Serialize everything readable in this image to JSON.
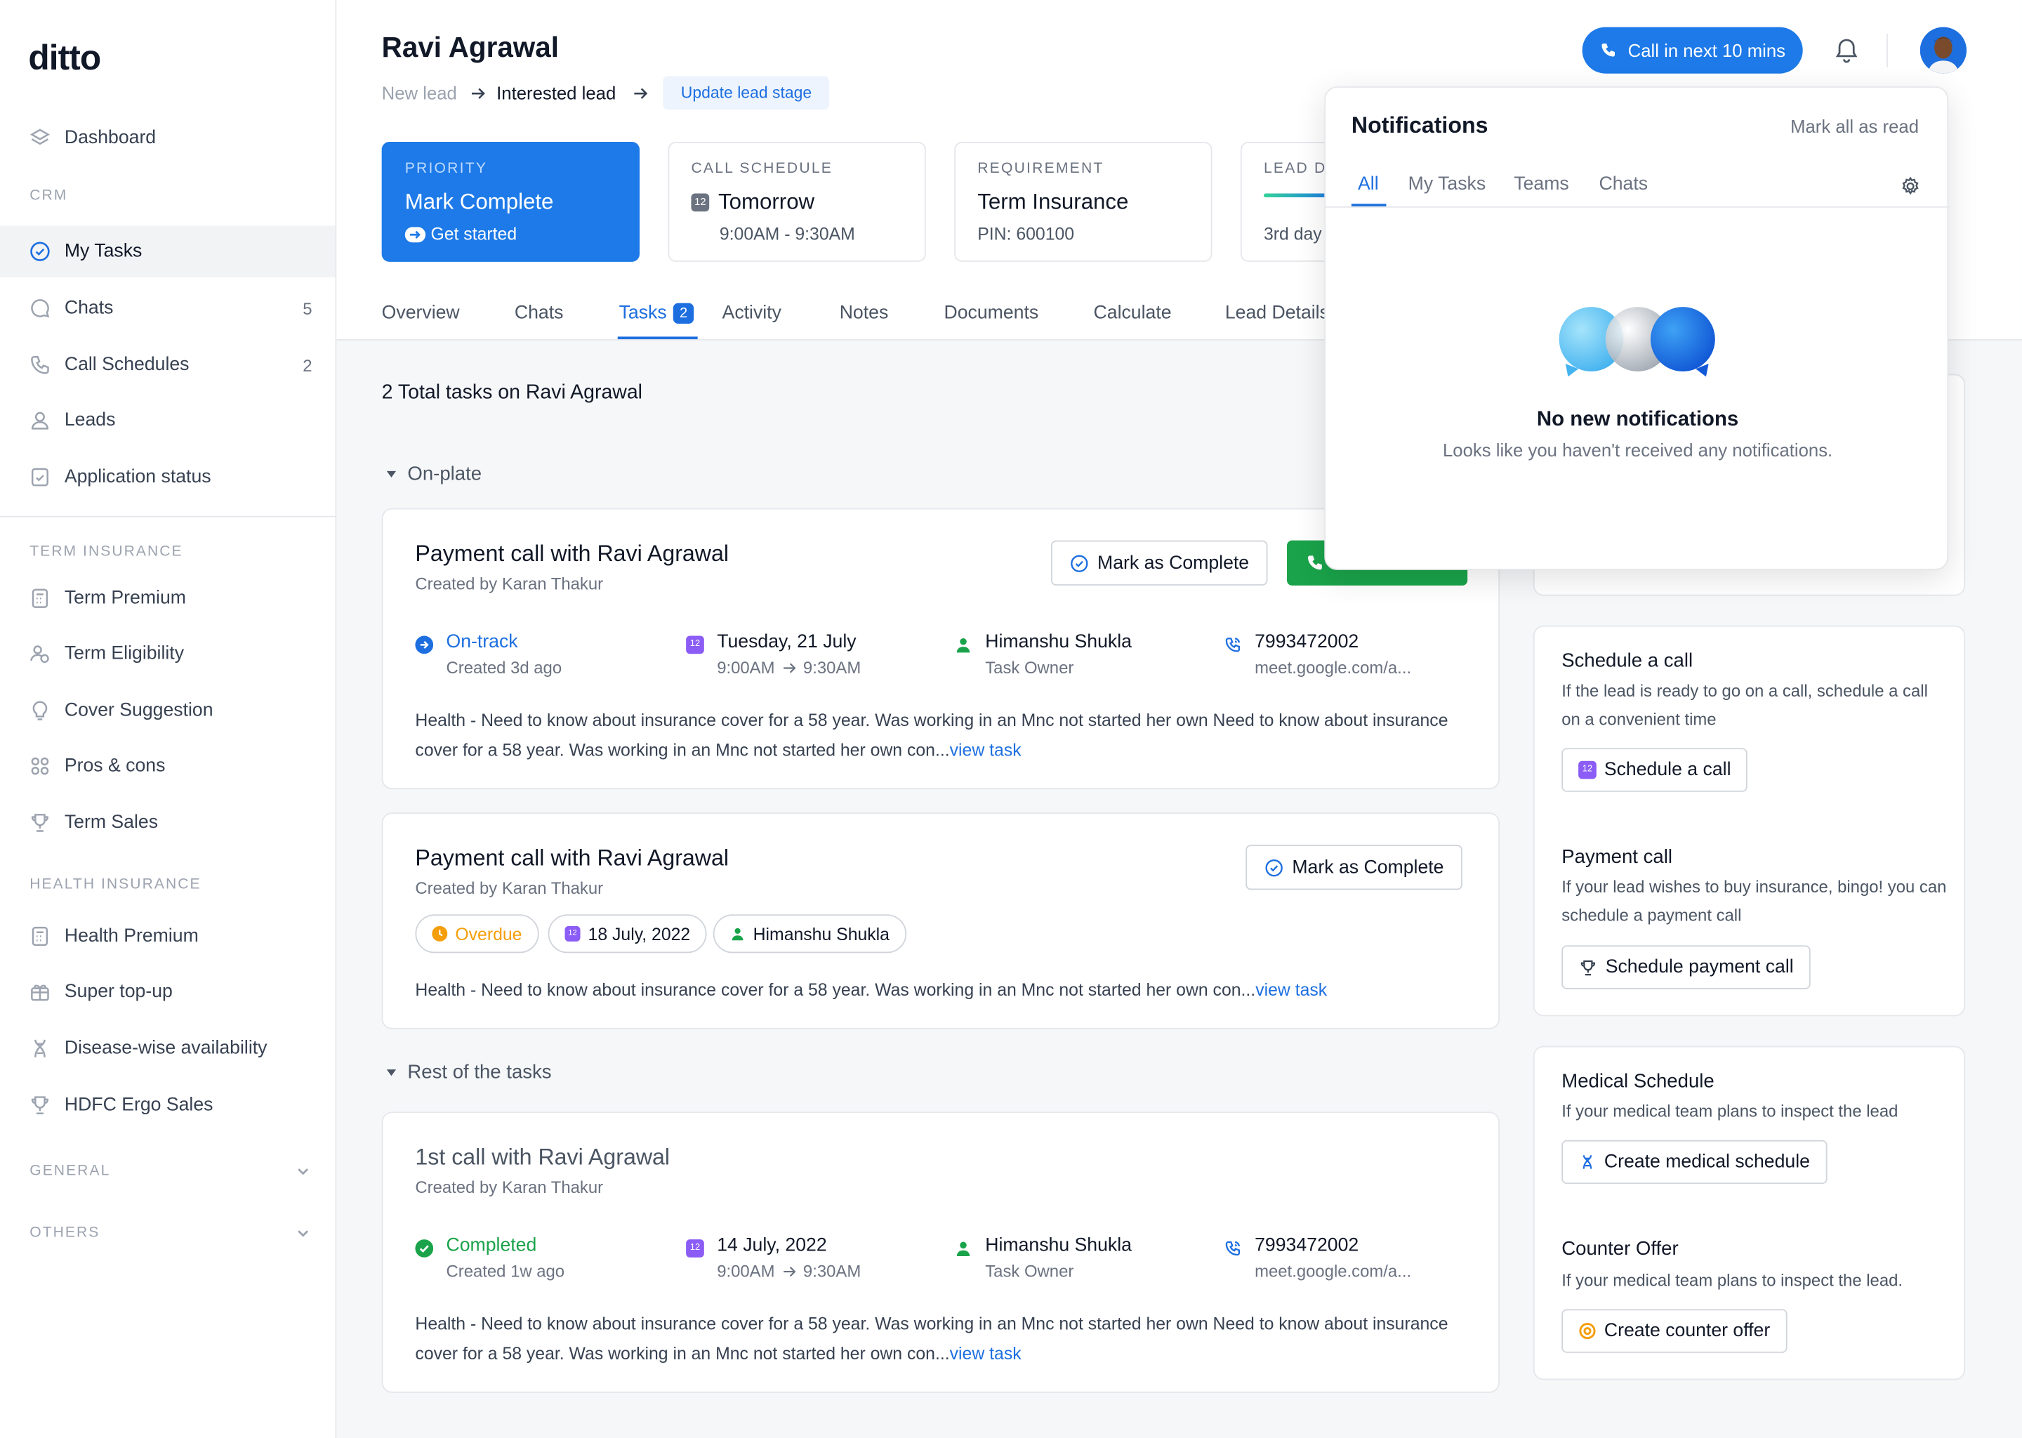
{
  "app": {
    "logo": "ditto"
  },
  "sidebar": {
    "dashboard": "Dashboard",
    "section_crm": "CRM",
    "crm_items": [
      {
        "label": "My Tasks",
        "count": ""
      },
      {
        "label": "Chats",
        "count": "5"
      },
      {
        "label": "Call Schedules",
        "count": "2"
      },
      {
        "label": "Leads",
        "count": ""
      },
      {
        "label": "Application status",
        "count": ""
      }
    ],
    "section_term": "TERM INSURANCE",
    "term_items": [
      "Term Premium",
      "Term Eligibility",
      "Cover Suggestion",
      "Pros & cons",
      "Term Sales"
    ],
    "section_health": "HEALTH INSURANCE",
    "health_items": [
      "Health Premium",
      "Super top-up",
      "Disease-wise availability",
      "HDFC Ergo Sales"
    ],
    "section_general": "GENERAL",
    "section_others": "OTHERS"
  },
  "header": {
    "lead_name": "Ravi Agrawal",
    "stage_prev": "New lead",
    "stage_current": "Interested lead",
    "update_stage": "Update lead stage",
    "call_button": "Call in next 10 mins"
  },
  "cards": {
    "priority": {
      "label": "PRIORITY",
      "value": "Mark Complete",
      "sub": "Get started"
    },
    "call_schedule": {
      "label": "CALL SCHEDULE",
      "value": "Tomorrow",
      "sub": "9:00AM - 9:30AM",
      "date_icon": "12"
    },
    "requirement": {
      "label": "REQUIREMENT",
      "value": "Term Insurance",
      "sub": "PIN: 600100"
    },
    "lead": {
      "label": "LEAD D",
      "sub": "3rd day",
      "progress": 0.45
    }
  },
  "tabs": {
    "overview": "Overview",
    "chats": "Chats",
    "tasks": "Tasks",
    "tasks_count": "2",
    "activity": "Activity",
    "notes": "Notes",
    "documents": "Documents",
    "calculate": "Calculate",
    "lead_details": "Lead Details"
  },
  "tasks": {
    "total": "2 Total tasks on Ravi Agrawal",
    "group_onplate": "On-plate",
    "group_rest": "Rest of the tasks",
    "mark_complete": "Mark as Complete",
    "task1": {
      "title": "Payment call with Ravi Agrawal",
      "created_by": "Created by Karan Thakur",
      "status": "On-track",
      "status_sub": "Created 3d ago",
      "date": "Tuesday, 21 July",
      "time_from": "9:00AM",
      "time_to": "9:30AM",
      "owner": "Himanshu Shukla",
      "owner_sub": "Task Owner",
      "phone": "7993472002",
      "meet": "meet.google.com/a...",
      "desc": "Health - Need to know about insurance cover for a 58 year. Was working in an Mnc not started her own Need to know about insurance cover for a 58 year. Was working in an Mnc not started her own con...",
      "view": "view task"
    },
    "task2": {
      "title": "Payment call with Ravi Agrawal",
      "created_by": "Created by Karan Thakur",
      "status": "Overdue",
      "date": "18 July, 2022",
      "owner": "Himanshu Shukla",
      "desc": "Health - Need to know about insurance cover for a 58 year. Was working in an Mnc not started her own con...",
      "view": "view task"
    },
    "task3": {
      "title": "1st call with Ravi Agrawal",
      "created_by": "Created by Karan Thakur",
      "status": "Completed",
      "status_sub": "Created 1w ago",
      "date": "14 July, 2022",
      "time_from": "9:00AM",
      "time_to": "9:30AM",
      "owner": "Himanshu Shukla",
      "owner_sub": "Task Owner",
      "phone": "7993472002",
      "meet": "meet.google.com/a...",
      "desc": "Health - Need to know about insurance cover for a 58 year. Was working in an Mnc not started her own Need to know about insurance cover for a 58 year. Was working in an Mnc not started her own con...",
      "view": "view task"
    }
  },
  "actions": {
    "schedule_call": {
      "title": "Schedule a call",
      "desc": "If the lead is ready to go on a call, schedule a call on a convenient time",
      "button": "Schedule a call"
    },
    "payment_call": {
      "title": "Payment call",
      "desc": "If your lead wishes to buy insurance, bingo! you can schedule a payment call",
      "button": "Schedule payment call"
    },
    "medical": {
      "title": "Medical Schedule",
      "desc": "If your medical team plans to inspect the lead",
      "button": "Create medical schedule"
    },
    "counter": {
      "title": "Counter Offer",
      "desc": "If your medical team plans to inspect the lead.",
      "button": "Create counter offer"
    }
  },
  "notifications": {
    "title": "Notifications",
    "mark_all": "Mark all as read",
    "tabs": [
      "All",
      "My Tasks",
      "Teams",
      "Chats"
    ],
    "empty_title": "No new notifications",
    "empty_desc": "Looks like you haven't received any notifications."
  },
  "colors": {
    "primary": "#1d7ae8",
    "success": "#1aa34a",
    "warning": "#f59e0b",
    "calendar": "#8b5cf6"
  }
}
